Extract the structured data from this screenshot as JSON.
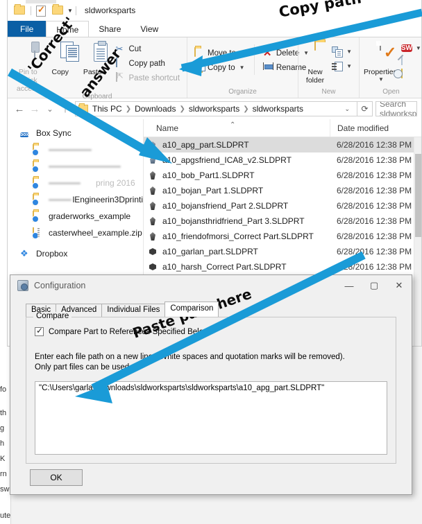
{
  "window": {
    "title": "sldworksparts",
    "quick_access": [
      "folder-icon",
      "properties-icon",
      "new-folder-icon",
      "dropdown-caret"
    ]
  },
  "ribbon": {
    "tabs": [
      {
        "label": "File",
        "active": false,
        "style": "file"
      },
      {
        "label": "Home",
        "active": true
      },
      {
        "label": "Share",
        "active": false
      },
      {
        "label": "View",
        "active": false
      }
    ],
    "groups": [
      {
        "label": "Clipboard",
        "big": [
          {
            "label": "Pin to Quick access",
            "icon": "pin-icon",
            "dim": true
          },
          {
            "label": "Copy",
            "icon": "copy-icon"
          },
          {
            "label": "Paste",
            "icon": "paste-icon"
          }
        ],
        "small": [
          {
            "label": "Cut",
            "icon": "scissors-icon",
            "dim": false
          },
          {
            "label": "Copy path",
            "icon": "copy-path-icon",
            "dim": false
          },
          {
            "label": "Paste shortcut",
            "icon": "paste-shortcut-icon",
            "dim": true
          }
        ]
      },
      {
        "label": "Organize",
        "small": [
          {
            "label": "Move to",
            "icon": "move-to-icon",
            "caret": true
          },
          {
            "label": "Copy to",
            "icon": "copy-to-icon",
            "caret": true
          },
          {
            "label": "Delete",
            "icon": "delete-icon",
            "caret": true
          },
          {
            "label": "Rename",
            "icon": "rename-icon",
            "caret": false
          }
        ]
      },
      {
        "label": "New",
        "big": [
          {
            "label": "New folder",
            "icon": "new-folder-icon"
          }
        ],
        "small": [
          {
            "label": "",
            "icon": "new-item-icon",
            "caret": true
          },
          {
            "label": "",
            "icon": "easy-access-icon",
            "caret": true
          }
        ]
      },
      {
        "label": "Open",
        "big": [
          {
            "label": "Properties",
            "icon": "properties-icon",
            "caret": true
          }
        ],
        "small": [
          {
            "label": "",
            "icon": "solidworks-open-icon",
            "caret": true
          },
          {
            "label": "",
            "icon": "edit-icon",
            "caret": false
          },
          {
            "label": "",
            "icon": "history-icon",
            "caret": false
          }
        ]
      }
    ]
  },
  "navbar": {
    "back": "back-arrow",
    "forward": "forward-arrow",
    "recent": "recent-locations-caret",
    "up": "up-arrow",
    "breadcrumbs": [
      "This PC",
      "Downloads",
      "sldworksparts",
      "sldworksparts"
    ],
    "dropdown": "address-dropdown-caret",
    "refresh": "refresh-icon",
    "search_placeholder": "Search sldworksparts"
  },
  "nav_pane": {
    "items": [
      {
        "label": "Box Sync",
        "icon": "box-sync-icon",
        "child": false,
        "redacted": false
      },
      {
        "label": "",
        "icon": "sync-folder-icon",
        "child": true,
        "redacted": true,
        "redact_width": 62
      },
      {
        "label": "",
        "icon": "sync-folder-icon",
        "child": true,
        "redacted": true,
        "redact_width": 104
      },
      {
        "label": "pring 2016",
        "icon": "sync-folder-icon",
        "child": true,
        "redacted": true,
        "redact_width": 46
      },
      {
        "label": "lEngineerin3Dprinti",
        "icon": "sync-folder-icon",
        "child": true,
        "redacted": true,
        "redact_width": 40
      },
      {
        "label": "graderworks_example",
        "icon": "sync-folder-icon",
        "child": true,
        "redacted": false
      },
      {
        "label": "casterwheel_example.zip",
        "icon": "zip-folder-icon",
        "child": true,
        "redacted": false
      },
      {
        "label": "Dropbox",
        "icon": "dropbox-icon",
        "child": false,
        "redacted": false
      }
    ]
  },
  "file_list": {
    "columns": [
      "Name",
      "Date modified"
    ],
    "sort_indicator": "ascending-caret",
    "rows": [
      {
        "name": "a10_apg_part.SLDPRT",
        "date": "6/28/2016 12:38 PM",
        "icon": "sldprt-icon-a",
        "selected": true
      },
      {
        "name": "a10_apgsfriend_ICA8_v2.SLDPRT",
        "date": "6/28/2016 12:38 PM",
        "icon": "sldprt-icon-a",
        "selected": false
      },
      {
        "name": "a10_bob_Part1.SLDPRT",
        "date": "6/28/2016 12:38 PM",
        "icon": "sldprt-icon-b",
        "selected": false
      },
      {
        "name": "a10_bojan_Part 1.SLDPRT",
        "date": "6/28/2016 12:38 PM",
        "icon": "sldprt-icon-b",
        "selected": false
      },
      {
        "name": "a10_bojansfriend_Part 2.SLDPRT",
        "date": "6/28/2016 12:38 PM",
        "icon": "sldprt-icon-b",
        "selected": false
      },
      {
        "name": "a10_bojansthridfriend_Part 3.SLDPRT",
        "date": "6/28/2016 12:38 PM",
        "icon": "sldprt-icon-b",
        "selected": false
      },
      {
        "name": "a10_friendofmorsi_Correct Part.SLDPRT",
        "date": "6/28/2016 12:38 PM",
        "icon": "sldprt-icon-b",
        "selected": false
      },
      {
        "name": "a10_garlan_part.SLDPRT",
        "date": "6/28/2016 12:38 PM",
        "icon": "sldprt-icon-c",
        "selected": false
      },
      {
        "name": "a10_harsh_Correct Part.SLDPRT",
        "date": "6/28/2016 12:38 PM",
        "icon": "sldprt-icon-c",
        "selected": false
      }
    ]
  },
  "dialog": {
    "title": "Configuration",
    "icon": "configuration-icon",
    "minimize": "—",
    "maximize": "▢",
    "close": "✕",
    "tabs": [
      {
        "label": "Basic",
        "active": false
      },
      {
        "label": "Advanced",
        "active": false
      },
      {
        "label": "Individual Files",
        "active": false
      },
      {
        "label": "Comparison",
        "active": true
      }
    ],
    "group_legend": "Compare",
    "checkbox_label": "Compare Part to References Specified Below",
    "checkbox_checked": true,
    "hint_line1": "Enter each file path on a new line ( White spaces and quotation marks will be removed).",
    "hint_line2": "Only part files can be used.",
    "path_value": "\"C:\\Users\\garla\\Downloads\\sldworksparts\\sldworksparts\\a10_apg_part.SLDPRT\"",
    "ok_label": "OK"
  },
  "annotations": {
    "accent_color": "#1a9bd7",
    "labels": [
      {
        "text": "Copy path",
        "name": "annotation-copy-path"
      },
      {
        "text": "'Correct'",
        "name": "annotation-correct"
      },
      {
        "text": "answer",
        "name": "annotation-answer"
      },
      {
        "text": "Paste path here",
        "name": "annotation-paste-path-here"
      }
    ]
  },
  "background_window": {
    "fragments": [
      "fo",
      "th",
      "g",
      "h",
      "K",
      "rn",
      "sw",
      "ute"
    ]
  }
}
